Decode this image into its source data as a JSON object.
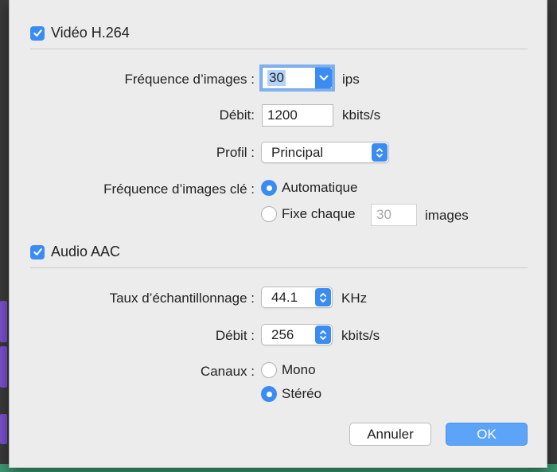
{
  "video": {
    "header": "Vidéo H.264",
    "framerate": {
      "label": "Fréquence d’images :",
      "value": "30",
      "unit": "ips"
    },
    "bitrate": {
      "label": "Débit:",
      "value": "1200",
      "unit": "kbits/s"
    },
    "profile": {
      "label": "Profil :",
      "value": "Principal"
    },
    "keyframes": {
      "label": "Fréquence d’images clé :",
      "auto_label": "Automatique",
      "fixed_label": "Fixe chaque",
      "fixed_value": "30",
      "fixed_unit": "images",
      "selected": "auto"
    }
  },
  "audio": {
    "header": "Audio AAC",
    "samplerate": {
      "label": "Taux d’échantillonnage :",
      "value": "44.1",
      "unit": "KHz"
    },
    "bitrate": {
      "label": "Débit :",
      "value": "256",
      "unit": "kbits/s"
    },
    "channels": {
      "label": "Canaux :",
      "mono_label": "Mono",
      "stereo_label": "Stéréo",
      "selected": "stereo"
    }
  },
  "buttons": {
    "cancel": "Annuler",
    "ok": "OK"
  },
  "colors": {
    "accent": "#3b8cf2",
    "ok_button": "#5ba4f8",
    "dialog_bg": "#ececec"
  }
}
